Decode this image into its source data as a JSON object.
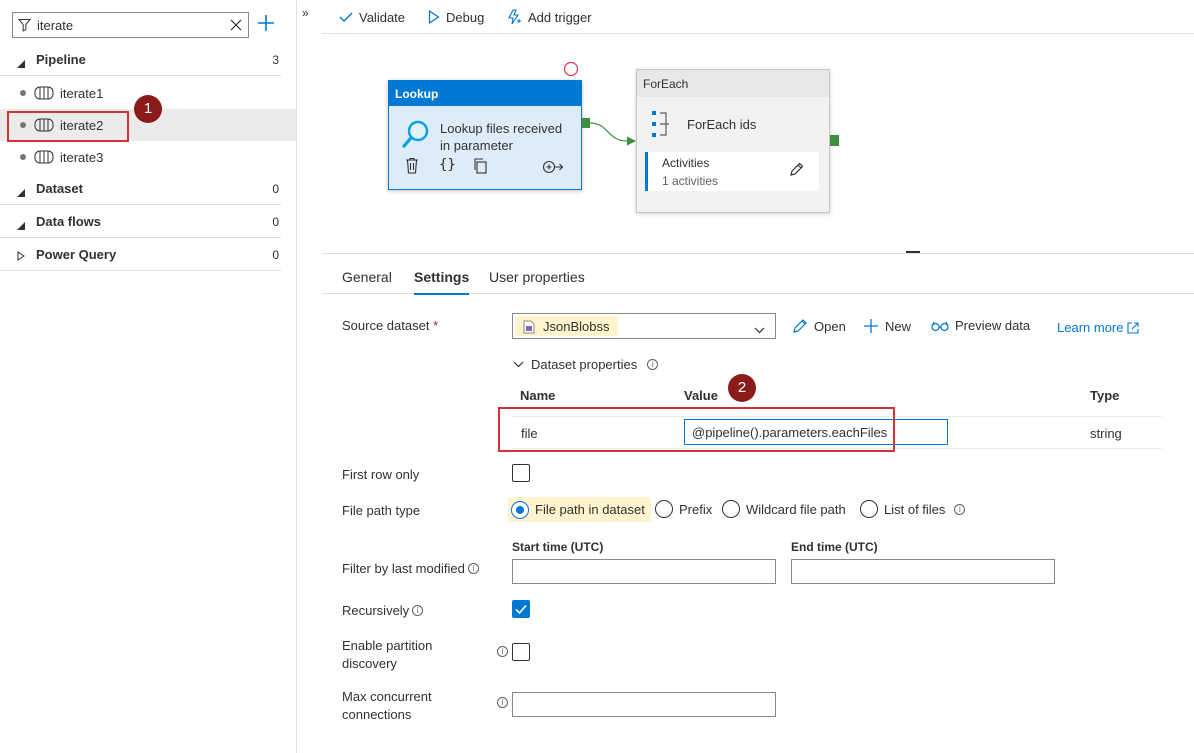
{
  "sidebar": {
    "search": {
      "value": "iterate",
      "placeholder": ""
    },
    "sections": {
      "pipeline": {
        "label": "Pipeline",
        "count": "3"
      },
      "dataset": {
        "label": "Dataset",
        "count": "0"
      },
      "dataflows": {
        "label": "Data flows",
        "count": "0"
      },
      "powerquery": {
        "label": "Power Query",
        "count": "0"
      }
    },
    "pipelines": [
      "iterate1",
      "iterate2",
      "iterate3"
    ],
    "selected_pipeline": "iterate2",
    "collapse_glyph": "»"
  },
  "toolbar": {
    "validate": "Validate",
    "debug": "Debug",
    "add_trigger": "Add trigger"
  },
  "canvas": {
    "lookup": {
      "type_label": "Lookup",
      "name_line1": "Lookup files received",
      "name_line2": "in parameter"
    },
    "foreach": {
      "type_label": "ForEach",
      "name": "ForEach ids",
      "activities_label": "Activities",
      "activities_count": "1 activities"
    }
  },
  "tabs": {
    "general": "General",
    "settings": "Settings",
    "user_properties": "User properties"
  },
  "settings": {
    "source_dataset_label": "Source dataset",
    "required_mark": "*",
    "source_dataset_value": "JsonBlobss",
    "open": "Open",
    "new": "New",
    "preview": "Preview data",
    "learn_more": "Learn more",
    "dataset_properties": "Dataset properties",
    "table": {
      "col_name": "Name",
      "col_value": "Value",
      "col_type": "Type",
      "row": {
        "name": "file",
        "value": "@pipeline().parameters.eachFiles",
        "type": "string"
      }
    },
    "first_row_only": "First row only",
    "file_path_type": "File path type",
    "radios": {
      "dataset": "File path in dataset",
      "prefix": "Prefix",
      "wildcard": "Wildcard file path",
      "list": "List of files"
    },
    "filter_label": "Filter by last modified",
    "start_time": "Start time (UTC)",
    "end_time": "End time (UTC)",
    "recursively": "Recursively",
    "enable_partition_line1": "Enable partition",
    "enable_partition_line2": "discovery",
    "max_conn_line1": "Max concurrent",
    "max_conn_line2": "connections"
  },
  "annotations": {
    "badge1": "1",
    "badge2": "2"
  },
  "colors": {
    "accent": "#0078d4",
    "annotation_red": "#d13438",
    "badge": "#8b1a1a",
    "highlight": "#fff4ce"
  }
}
